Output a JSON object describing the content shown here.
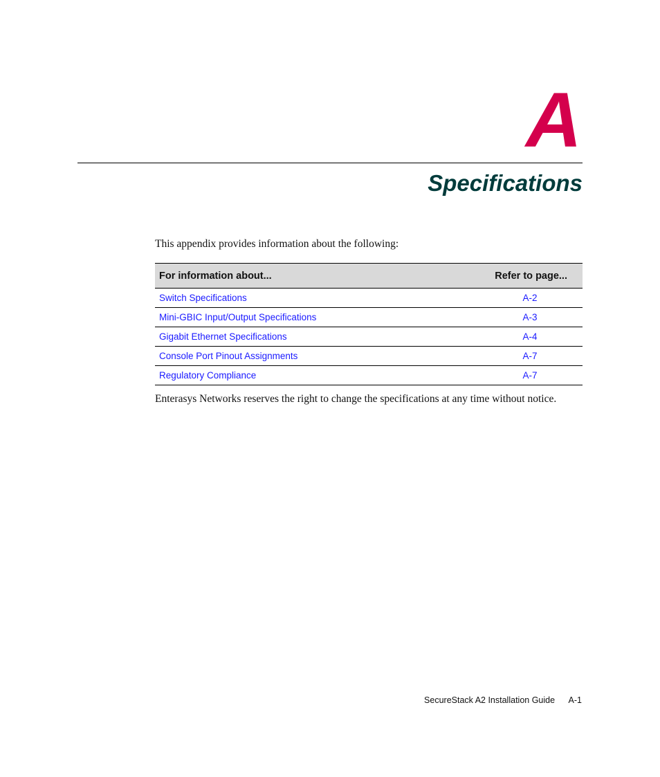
{
  "chapter": {
    "letter": "A",
    "title": "Specifications"
  },
  "intro": "This appendix provides information about the following:",
  "toc": {
    "headers": [
      "For information about...",
      "Refer to page..."
    ],
    "rows": [
      {
        "topic": "Switch Specifications",
        "page": "A-2"
      },
      {
        "topic": "Mini-GBIC Input/Output Specifications",
        "page": "A-3"
      },
      {
        "topic": "Gigabit Ethernet Specifications",
        "page": "A-4"
      },
      {
        "topic": "Console Port Pinout Assignments",
        "page": "A-7"
      },
      {
        "topic": "Regulatory Compliance",
        "page": "A-7"
      }
    ]
  },
  "notice": "Enterasys Networks reserves the right to change the specifications at any time without notice.",
  "footer": {
    "guide_title": "SecureStack A2 Installation Guide",
    "page_number": "A-1"
  },
  "colors": {
    "chapter_letter": "#d4004c",
    "chapter_title": "#003b3b",
    "link": "#1a1aff"
  }
}
